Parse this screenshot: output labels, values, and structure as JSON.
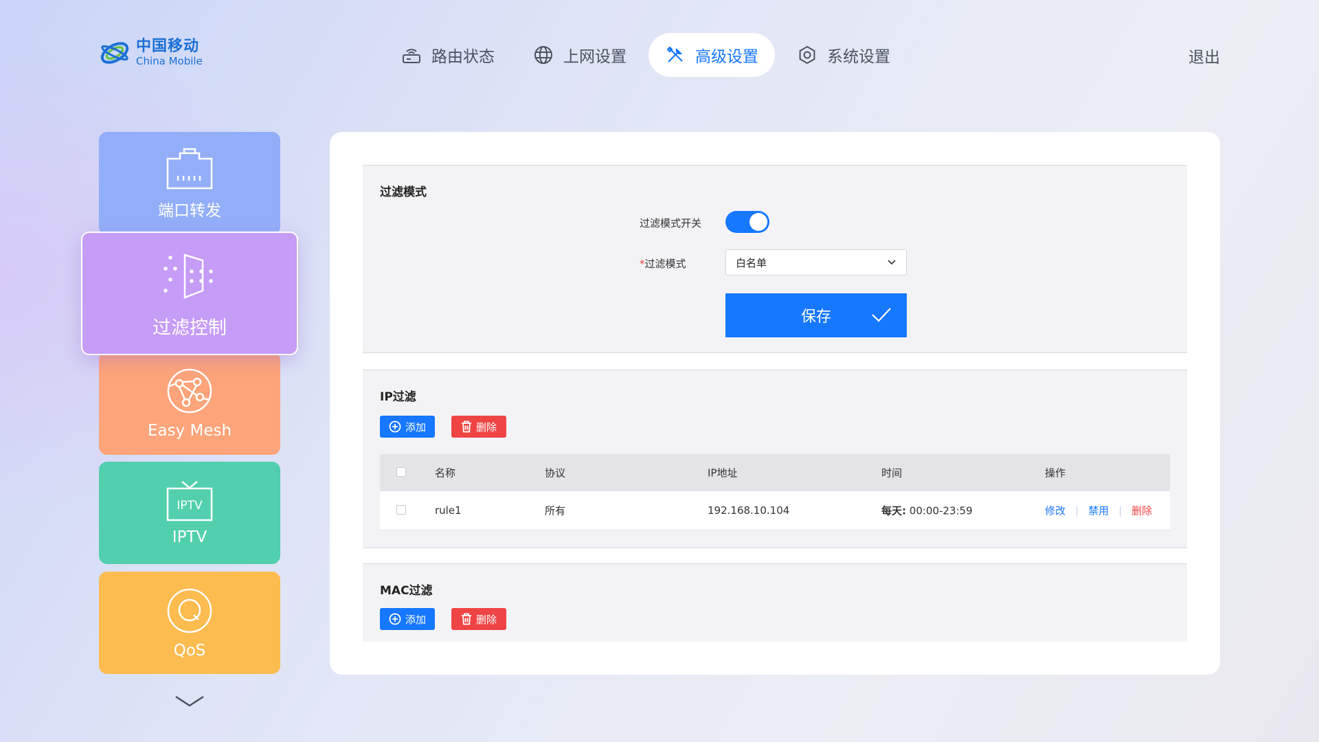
{
  "brand": {
    "name_cn": "中国移动",
    "name_en": "China Mobile"
  },
  "nav": {
    "items": [
      {
        "label": "路由状态",
        "icon": "router-icon"
      },
      {
        "label": "上网设置",
        "icon": "globe-icon"
      },
      {
        "label": "高级设置",
        "icon": "tools-icon",
        "active": true
      },
      {
        "label": "系统设置",
        "icon": "settings-hex-icon"
      }
    ],
    "logout": "退出"
  },
  "sidebar": {
    "items": [
      {
        "label": "端口转发",
        "icon": "ethernet-port-icon",
        "color": "#93aef9"
      },
      {
        "label": "过滤控制",
        "icon": "filter-door-icon",
        "color": "#c59cf6",
        "active": true
      },
      {
        "label": "Easy Mesh",
        "icon": "mesh-network-icon",
        "color": "#fda47a"
      },
      {
        "label": "IPTV",
        "icon": "tv-icon",
        "color": "#52cfad",
        "icon_text": "IPTV"
      },
      {
        "label": "QoS",
        "icon": "qos-icon",
        "color": "#fdbc50"
      }
    ],
    "more_icon": "chevron-down-icon"
  },
  "filter_mode": {
    "title": "过滤模式",
    "switch_label": "过滤模式开关",
    "switch_on": true,
    "mode_label": "过滤模式",
    "mode_required_mark": "*",
    "mode_value": "白名单",
    "save_label": "保存"
  },
  "ip_filter": {
    "title": "IP过滤",
    "add_label": "添加",
    "delete_label": "删除",
    "columns": [
      "名称",
      "协议",
      "IP地址",
      "时间",
      "操作"
    ],
    "rows": [
      {
        "name": "rule1",
        "protocol": "所有",
        "ip": "192.168.10.104",
        "time_prefix": "每天:",
        "time_range": "00:00-23:59",
        "actions": {
          "edit": "修改",
          "disable": "禁用",
          "delete": "删除"
        }
      }
    ]
  },
  "mac_filter": {
    "title": "MAC过滤",
    "add_label": "添加",
    "delete_label": "删除"
  },
  "colors": {
    "accent": "#1677ff",
    "danger": "#ef4444"
  }
}
